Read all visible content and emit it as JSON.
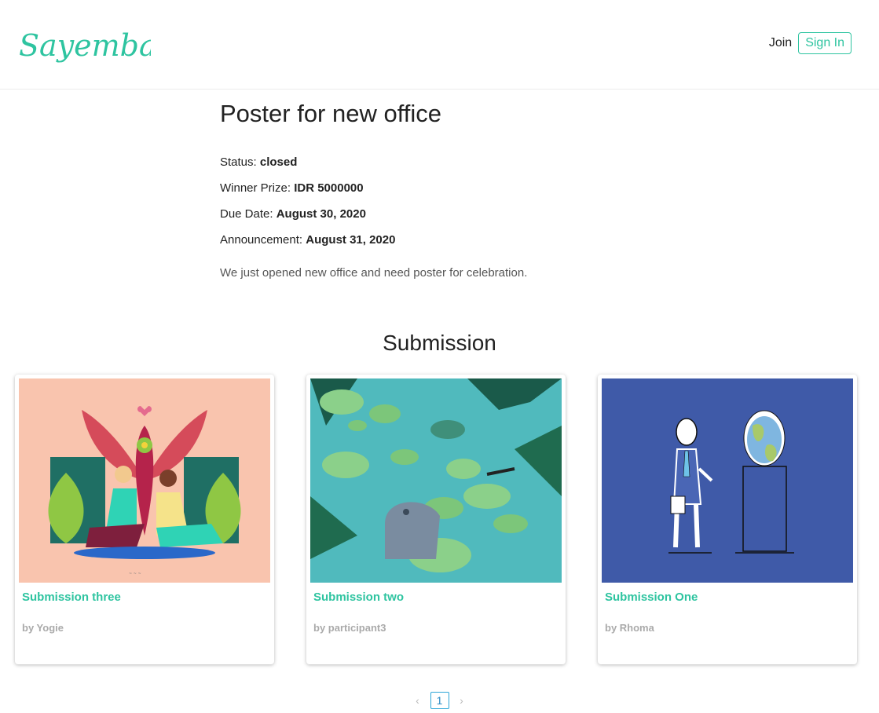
{
  "brand": {
    "name": "Sayembara",
    "color": "#2ec4a0"
  },
  "nav": {
    "join_label": "Join",
    "signin_label": "Sign In"
  },
  "contest": {
    "title": "Poster for new office",
    "status_label": "Status: ",
    "status_value": "closed",
    "prize_label": "Winner Prize: ",
    "prize_value": "IDR 5000000",
    "due_label": "Due Date: ",
    "due_value": "August 30, 2020",
    "announce_label": "Announcement: ",
    "announce_value": "August 31, 2020",
    "description": "We just opened new office and need poster for celebration."
  },
  "submission_section": {
    "title": "Submission"
  },
  "submissions": [
    {
      "title": "Submission three",
      "author": "by Yogie",
      "image": "illustration-couple-plants"
    },
    {
      "title": "Submission two",
      "author": "by participant3",
      "image": "illustration-lily-pond"
    },
    {
      "title": "Submission One",
      "author": "by Rhoma",
      "image": "illustration-man-globe"
    }
  ],
  "pagination": {
    "prev_icon": "chevron-left-icon",
    "current_page": "1",
    "next_icon": "chevron-right-icon"
  }
}
